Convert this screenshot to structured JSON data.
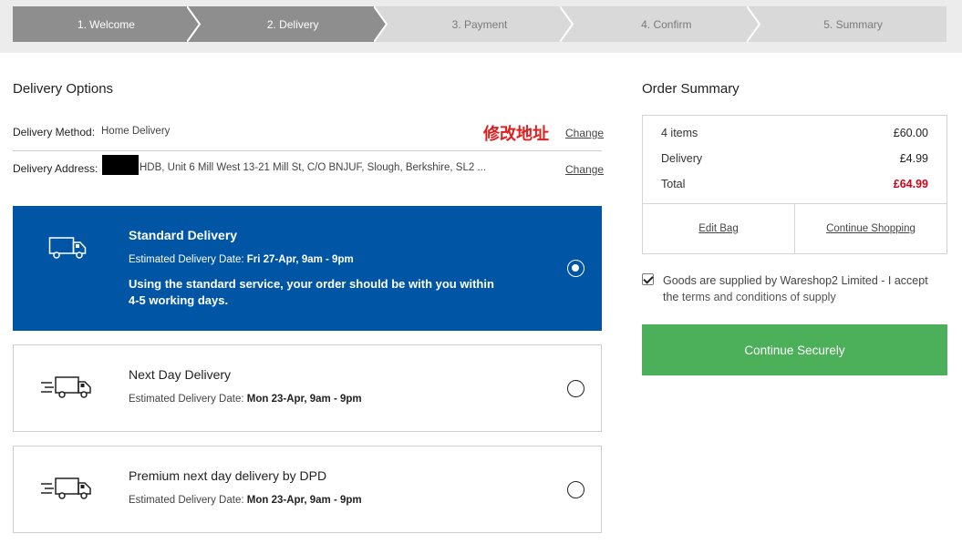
{
  "stepper": [
    {
      "label": "1. Welcome",
      "state": "active"
    },
    {
      "label": "2. Delivery",
      "state": "active"
    },
    {
      "label": "3. Payment",
      "state": "inactive"
    },
    {
      "label": "4. Confirm",
      "state": "inactive"
    },
    {
      "label": "5. Summary",
      "state": "inactive"
    }
  ],
  "delivery": {
    "title": "Delivery Options",
    "method_label": "Delivery Method:",
    "method_value": "Home Delivery",
    "annotation": "修改地址",
    "change_label": "Change",
    "address_label": "Delivery Address:",
    "address_value": "HDB, Unit 6 Mill West 13-21 Mill St, C/O BNJUF, Slough, Berkshire, SL2 ..."
  },
  "options": [
    {
      "title": "Standard Delivery",
      "date_label": "Estimated Delivery Date:",
      "date_value": "Fri 27-Apr,  9am - 9pm",
      "description": "Using the standard service, your order should be with you within 4-5 working days.",
      "selected": true,
      "icon": "truck-icon"
    },
    {
      "title": "Next Day Delivery",
      "date_label": "Estimated Delivery Date:",
      "date_value": "Mon 23-Apr,  9am - 9pm",
      "selected": false,
      "icon": "fast-truck-icon"
    },
    {
      "title": "Premium next day delivery by DPD",
      "date_label": "Estimated Delivery Date:",
      "date_value": "Mon 23-Apr,  9am - 9pm",
      "selected": false,
      "icon": "fast-truck-icon"
    }
  ],
  "summary": {
    "title": "Order Summary",
    "items_label": "4 items",
    "items_value": "£60.00",
    "delivery_label": "Delivery",
    "delivery_value": "£4.99",
    "total_label": "Total",
    "total_value": "£64.99",
    "edit_bag": "Edit Bag",
    "continue_shopping": "Continue Shopping"
  },
  "terms": {
    "checked": true,
    "text_prefix": "Goods are supplied by Wareshop2 Limited - I accept the ",
    "link_text": "terms and conditions of supply"
  },
  "continue_button": "Continue Securely",
  "colors": {
    "selected_option": "#0056a4",
    "continue_button": "#4caf5a",
    "total_price": "#d0021b",
    "annotation": "#e02020"
  }
}
